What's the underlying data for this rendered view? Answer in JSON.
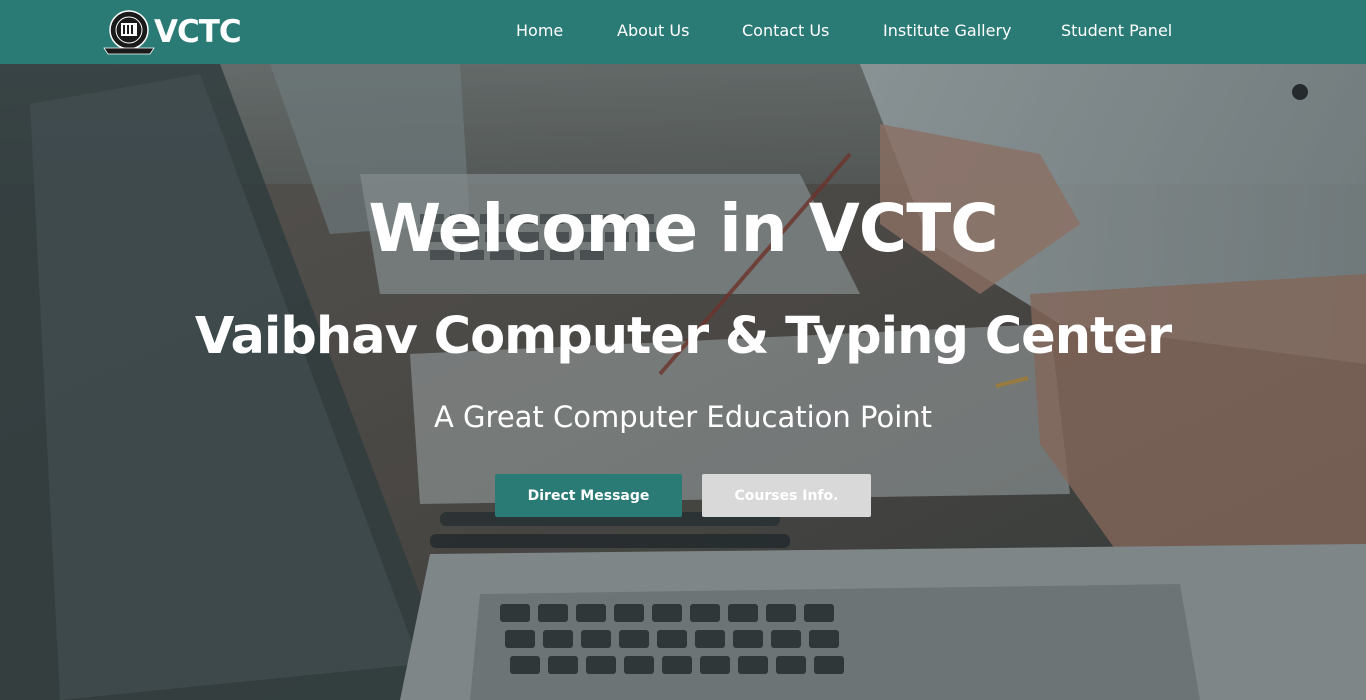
{
  "brand": {
    "name": "VCTC",
    "emblem_icon": "vctc-seal-logo"
  },
  "nav": {
    "items": [
      {
        "label": "Home"
      },
      {
        "label": "About Us"
      },
      {
        "label": "Contact Us"
      },
      {
        "label": "Institute Gallery"
      },
      {
        "label": "Student Panel"
      }
    ]
  },
  "hero": {
    "title": "Welcome in VCTC",
    "subtitle": "Vaibhav Computer & Typing Center",
    "tagline": "A Great Computer Education Point",
    "buttons": {
      "primary_label": "Direct Message",
      "secondary_label": "Courses Info."
    }
  },
  "colors": {
    "accent": "#2a7a76",
    "secondary_button": "#d9d9d9",
    "text": "#ffffff"
  }
}
